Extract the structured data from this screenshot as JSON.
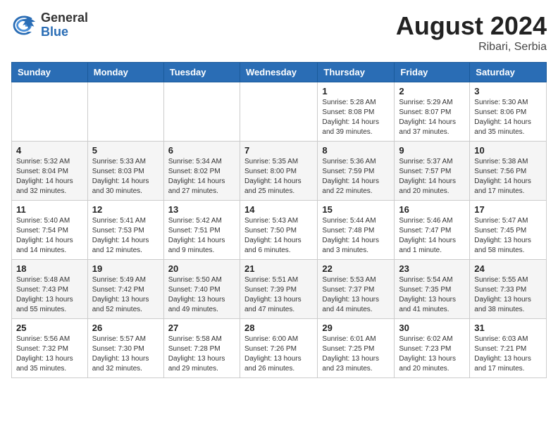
{
  "header": {
    "logo_general": "General",
    "logo_blue": "Blue",
    "month_year": "August 2024",
    "location": "Ribari, Serbia"
  },
  "days_of_week": [
    "Sunday",
    "Monday",
    "Tuesday",
    "Wednesday",
    "Thursday",
    "Friday",
    "Saturday"
  ],
  "weeks": [
    [
      {
        "day": "",
        "info": ""
      },
      {
        "day": "",
        "info": ""
      },
      {
        "day": "",
        "info": ""
      },
      {
        "day": "",
        "info": ""
      },
      {
        "day": "1",
        "info": "Sunrise: 5:28 AM\nSunset: 8:08 PM\nDaylight: 14 hours\nand 39 minutes."
      },
      {
        "day": "2",
        "info": "Sunrise: 5:29 AM\nSunset: 8:07 PM\nDaylight: 14 hours\nand 37 minutes."
      },
      {
        "day": "3",
        "info": "Sunrise: 5:30 AM\nSunset: 8:06 PM\nDaylight: 14 hours\nand 35 minutes."
      }
    ],
    [
      {
        "day": "4",
        "info": "Sunrise: 5:32 AM\nSunset: 8:04 PM\nDaylight: 14 hours\nand 32 minutes."
      },
      {
        "day": "5",
        "info": "Sunrise: 5:33 AM\nSunset: 8:03 PM\nDaylight: 14 hours\nand 30 minutes."
      },
      {
        "day": "6",
        "info": "Sunrise: 5:34 AM\nSunset: 8:02 PM\nDaylight: 14 hours\nand 27 minutes."
      },
      {
        "day": "7",
        "info": "Sunrise: 5:35 AM\nSunset: 8:00 PM\nDaylight: 14 hours\nand 25 minutes."
      },
      {
        "day": "8",
        "info": "Sunrise: 5:36 AM\nSunset: 7:59 PM\nDaylight: 14 hours\nand 22 minutes."
      },
      {
        "day": "9",
        "info": "Sunrise: 5:37 AM\nSunset: 7:57 PM\nDaylight: 14 hours\nand 20 minutes."
      },
      {
        "day": "10",
        "info": "Sunrise: 5:38 AM\nSunset: 7:56 PM\nDaylight: 14 hours\nand 17 minutes."
      }
    ],
    [
      {
        "day": "11",
        "info": "Sunrise: 5:40 AM\nSunset: 7:54 PM\nDaylight: 14 hours\nand 14 minutes."
      },
      {
        "day": "12",
        "info": "Sunrise: 5:41 AM\nSunset: 7:53 PM\nDaylight: 14 hours\nand 12 minutes."
      },
      {
        "day": "13",
        "info": "Sunrise: 5:42 AM\nSunset: 7:51 PM\nDaylight: 14 hours\nand 9 minutes."
      },
      {
        "day": "14",
        "info": "Sunrise: 5:43 AM\nSunset: 7:50 PM\nDaylight: 14 hours\nand 6 minutes."
      },
      {
        "day": "15",
        "info": "Sunrise: 5:44 AM\nSunset: 7:48 PM\nDaylight: 14 hours\nand 3 minutes."
      },
      {
        "day": "16",
        "info": "Sunrise: 5:46 AM\nSunset: 7:47 PM\nDaylight: 14 hours\nand 1 minute."
      },
      {
        "day": "17",
        "info": "Sunrise: 5:47 AM\nSunset: 7:45 PM\nDaylight: 13 hours\nand 58 minutes."
      }
    ],
    [
      {
        "day": "18",
        "info": "Sunrise: 5:48 AM\nSunset: 7:43 PM\nDaylight: 13 hours\nand 55 minutes."
      },
      {
        "day": "19",
        "info": "Sunrise: 5:49 AM\nSunset: 7:42 PM\nDaylight: 13 hours\nand 52 minutes."
      },
      {
        "day": "20",
        "info": "Sunrise: 5:50 AM\nSunset: 7:40 PM\nDaylight: 13 hours\nand 49 minutes."
      },
      {
        "day": "21",
        "info": "Sunrise: 5:51 AM\nSunset: 7:39 PM\nDaylight: 13 hours\nand 47 minutes."
      },
      {
        "day": "22",
        "info": "Sunrise: 5:53 AM\nSunset: 7:37 PM\nDaylight: 13 hours\nand 44 minutes."
      },
      {
        "day": "23",
        "info": "Sunrise: 5:54 AM\nSunset: 7:35 PM\nDaylight: 13 hours\nand 41 minutes."
      },
      {
        "day": "24",
        "info": "Sunrise: 5:55 AM\nSunset: 7:33 PM\nDaylight: 13 hours\nand 38 minutes."
      }
    ],
    [
      {
        "day": "25",
        "info": "Sunrise: 5:56 AM\nSunset: 7:32 PM\nDaylight: 13 hours\nand 35 minutes."
      },
      {
        "day": "26",
        "info": "Sunrise: 5:57 AM\nSunset: 7:30 PM\nDaylight: 13 hours\nand 32 minutes."
      },
      {
        "day": "27",
        "info": "Sunrise: 5:58 AM\nSunset: 7:28 PM\nDaylight: 13 hours\nand 29 minutes."
      },
      {
        "day": "28",
        "info": "Sunrise: 6:00 AM\nSunset: 7:26 PM\nDaylight: 13 hours\nand 26 minutes."
      },
      {
        "day": "29",
        "info": "Sunrise: 6:01 AM\nSunset: 7:25 PM\nDaylight: 13 hours\nand 23 minutes."
      },
      {
        "day": "30",
        "info": "Sunrise: 6:02 AM\nSunset: 7:23 PM\nDaylight: 13 hours\nand 20 minutes."
      },
      {
        "day": "31",
        "info": "Sunrise: 6:03 AM\nSunset: 7:21 PM\nDaylight: 13 hours\nand 17 minutes."
      }
    ]
  ]
}
